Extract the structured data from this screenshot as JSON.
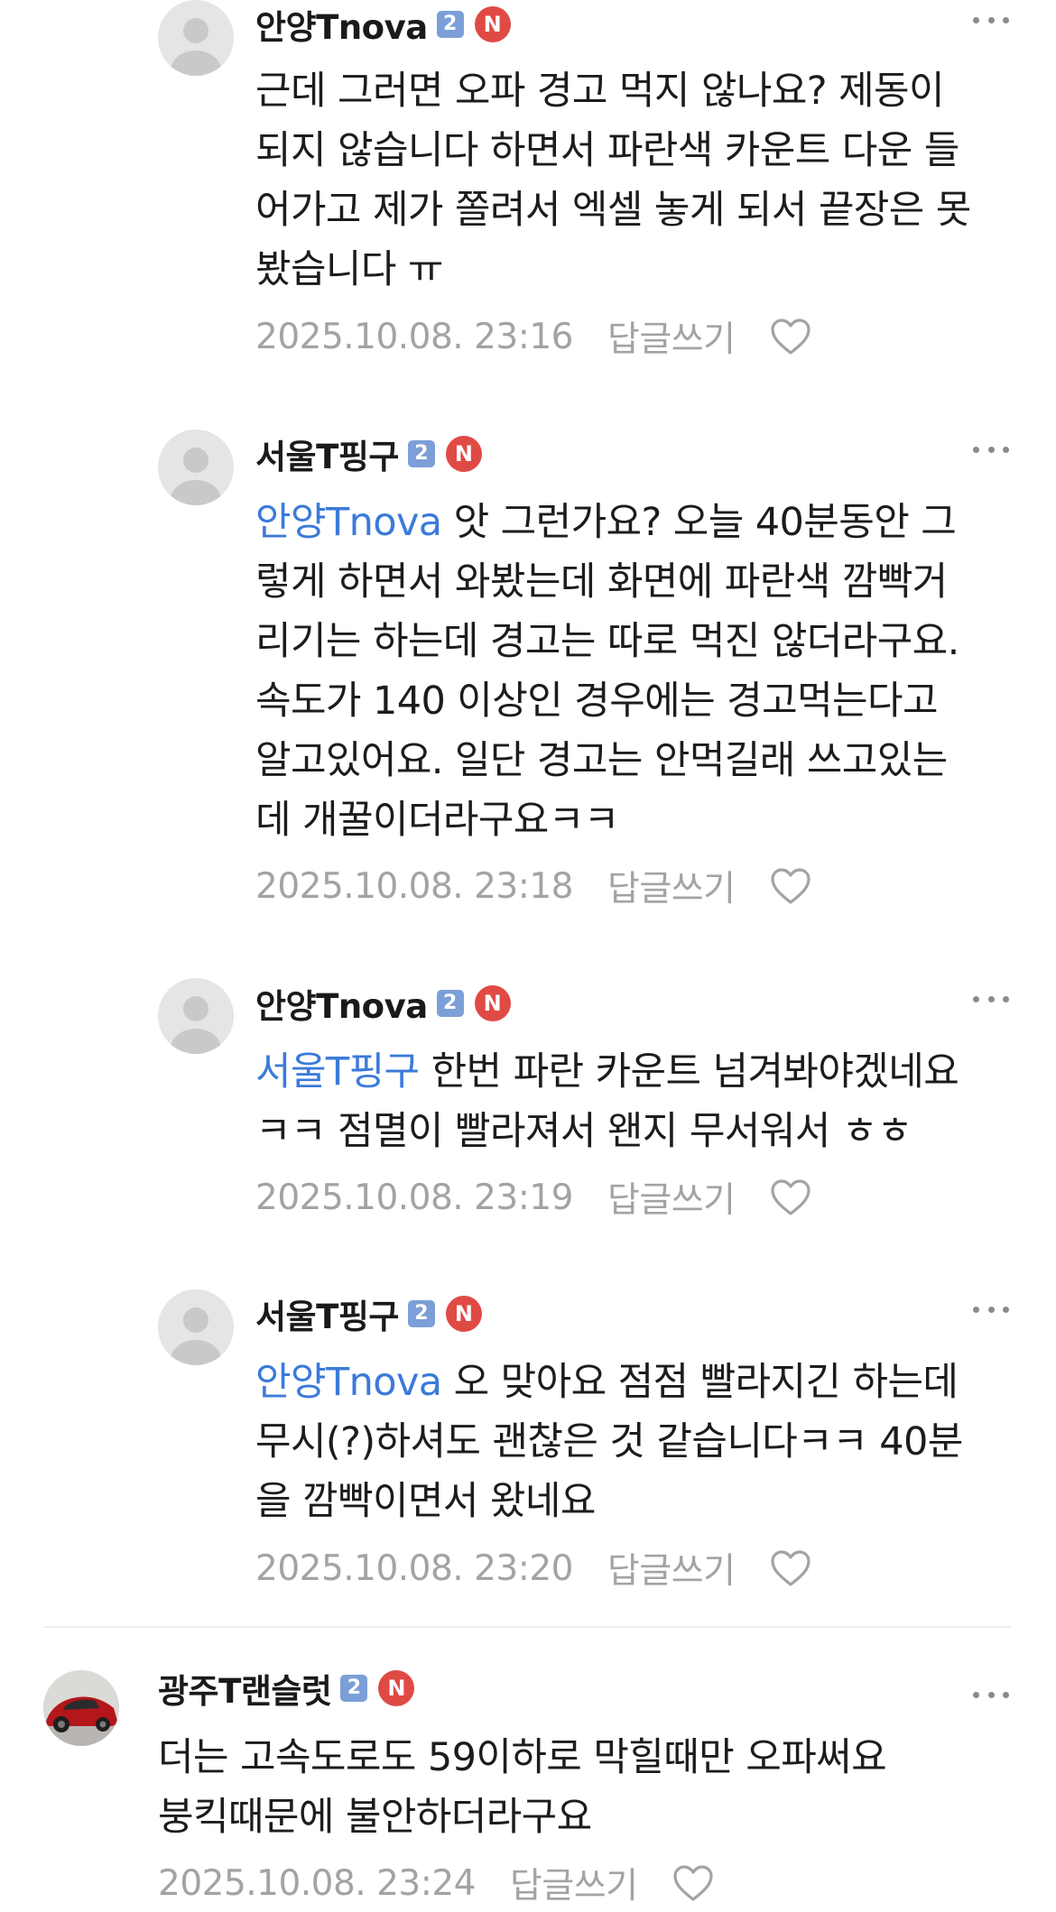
{
  "comments": [
    {
      "nickname": "안양Tnova",
      "level": "2",
      "badge": "N",
      "mention": "",
      "lines": [
        "근데 그러면 오파 경고 먹지 않나요? 제동이",
        "되지 않습니다 하면서 파란색 카운트 다운 들",
        "어가고 제가 쫄려서 엑셀 놓게 되서 끝장은 못",
        "봤습니다 ㅠ"
      ],
      "timestamp": "2025.10.08. 23:16",
      "reply_label": "답글쓰기"
    },
    {
      "nickname": "서울T핑구",
      "level": "2",
      "badge": "N",
      "mention": "안양Tnova",
      "first_line_rest": " 앗 그런가요? 오늘 40분동안 그",
      "lines": [
        "렇게 하면서 와봤는데 화면에 파란색 깜빡거",
        "리기는 하는데 경고는 따로 먹진 않더라구요.",
        "속도가 140 이상인 경우에는 경고먹는다고",
        "알고있어요. 일단 경고는 안먹길래 쓰고있는",
        "데 개꿀이더라구요ㅋㅋ"
      ],
      "timestamp": "2025.10.08. 23:18",
      "reply_label": "답글쓰기"
    },
    {
      "nickname": "안양Tnova",
      "level": "2",
      "badge": "N",
      "mention": "서울T핑구",
      "first_line_rest": " 한번 파란 카운트 넘겨봐야겠네요",
      "lines": [
        "ㅋㅋ 점멸이 빨라져서 왠지 무서워서 ㅎㅎ"
      ],
      "timestamp": "2025.10.08. 23:19",
      "reply_label": "답글쓰기"
    },
    {
      "nickname": "서울T핑구",
      "level": "2",
      "badge": "N",
      "mention": "안양Tnova",
      "first_line_rest": " 오 맞아요 점점 빨라지긴 하는데",
      "lines": [
        "무시(?)하셔도 괜찮은 것 같습니다ㅋㅋ 40분",
        "을 깜빡이면서 왔네요"
      ],
      "timestamp": "2025.10.08. 23:20",
      "reply_label": "답글쓰기"
    },
    {
      "nickname": "광주T랜슬럿",
      "level": "2",
      "badge": "N",
      "mention": "",
      "lines": [
        "더는 고속도로도 59이하로 막힐때만 오파써요",
        "붕킥때문에 불안하더라구요"
      ],
      "timestamp": "2025.10.08. 23:24",
      "reply_label": "답글쓰기"
    }
  ],
  "colors": {
    "mention": "#3b7ad9",
    "level_badge": "#7c9fd8",
    "n_badge": "#e04a45",
    "meta_text": "#a3a3a3"
  },
  "icons": {
    "more": "more-dots-icon",
    "like": "heart-icon",
    "avatar_default": "default-avatar-icon"
  }
}
